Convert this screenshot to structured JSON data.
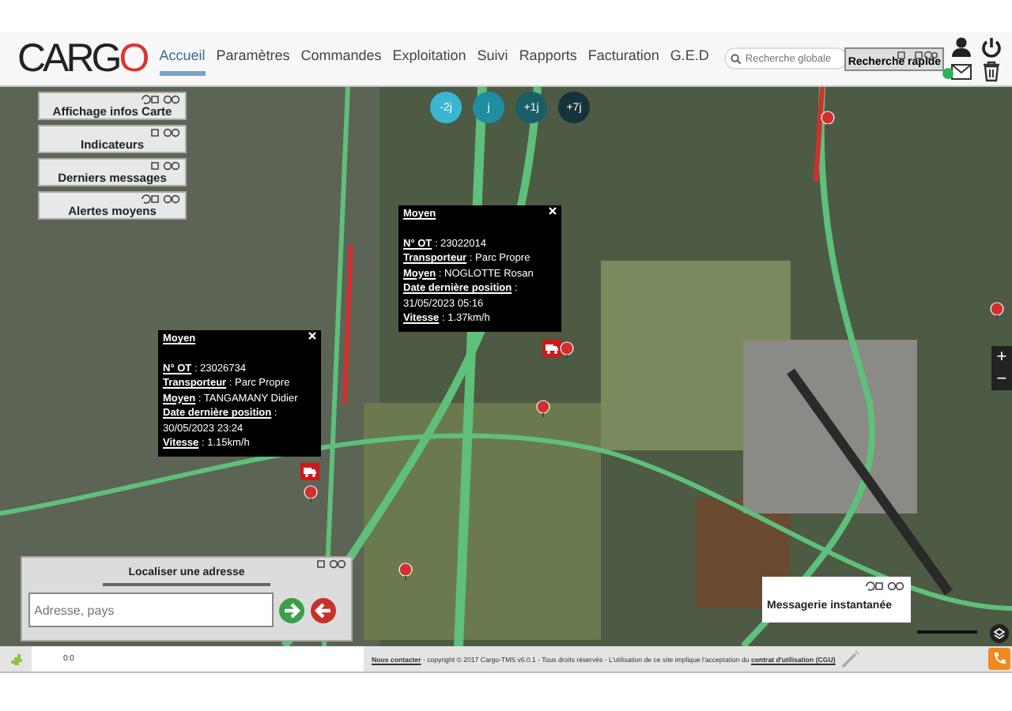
{
  "header": {
    "logo": {
      "text": "CARG",
      "accent": "O"
    },
    "nav": [
      {
        "label": "Accueil",
        "selected": true
      },
      {
        "label": "Paramètres",
        "selected": false
      },
      {
        "label": "Commandes",
        "selected": false
      },
      {
        "label": "Exploitation",
        "selected": false
      },
      {
        "label": "Suivi",
        "selected": false
      },
      {
        "label": "Rapports",
        "selected": false
      },
      {
        "label": "Facturation",
        "selected": false
      },
      {
        "label": "G.E.D",
        "selected": false
      }
    ],
    "search": {
      "placeholder": "Recherche globale"
    },
    "quick_search": {
      "label": "Recherche rapide"
    }
  },
  "map": {
    "panels": [
      {
        "title": "Affichage infos Carte",
        "refresh": true
      },
      {
        "title": "Indicateurs",
        "refresh": false
      },
      {
        "title": "Derniers messages",
        "refresh": false
      },
      {
        "title": "Alertes moyens",
        "refresh": true
      }
    ],
    "day_buttons": [
      {
        "label": "-2j",
        "color": "#3bb6d0"
      },
      {
        "label": "j",
        "color": "#1e8fa0"
      },
      {
        "label": "+1j",
        "color": "#1a5f68"
      },
      {
        "label": "+7j",
        "color": "#15333a"
      }
    ],
    "popups": [
      {
        "title": "Moyen",
        "fields": [
          {
            "label": "N° OT",
            "separator": ":",
            "value": "23022014",
            "kind": "inline"
          },
          {
            "label": "Transporteur",
            "separator": ":",
            "value": "Parc Propre",
            "kind": "inline"
          },
          {
            "label": "Moyen",
            "separator": ":",
            "value": "NOGLOTTE Rosan",
            "kind": "inline"
          },
          {
            "label": "Date dernière position",
            "separator": ":",
            "value": "31/05/2023 05:16",
            "kind": "block"
          },
          {
            "label": "Vitesse",
            "separator": ":",
            "value": "1.37km/h",
            "kind": "inline"
          }
        ]
      },
      {
        "title": "Moyen",
        "fields": [
          {
            "label": "N° OT",
            "separator": ":",
            "value": "23026734",
            "kind": "inline"
          },
          {
            "label": "Transporteur",
            "separator": ":",
            "value": "Parc Propre",
            "kind": "inline"
          },
          {
            "label": "Moyen",
            "separator": ":",
            "value": "TANGAMANY Didier",
            "kind": "inline"
          },
          {
            "label": "Date dernière position",
            "separator": ":",
            "value": "30/05/2023 23:24",
            "kind": "block"
          },
          {
            "label": "Vitesse",
            "separator": ":",
            "value": "1.15km/h",
            "kind": "inline"
          }
        ]
      }
    ],
    "zoom": {
      "in": "+",
      "out": "−"
    },
    "locate": {
      "title": "Localiser une adresse",
      "placeholder": "Adresse, pays"
    },
    "messaging": {
      "title": "Messagerie instantanée"
    }
  },
  "footer": {
    "coords": "0:0",
    "contact": "Nous contacter",
    "text": " - copyright © 2017 Cargo-TMS v6.0.1 - Tous droits réservés - L'utilisation de ce site implique l'acceptation du ",
    "terms": "contrat d'utilisation (CGU)"
  }
}
